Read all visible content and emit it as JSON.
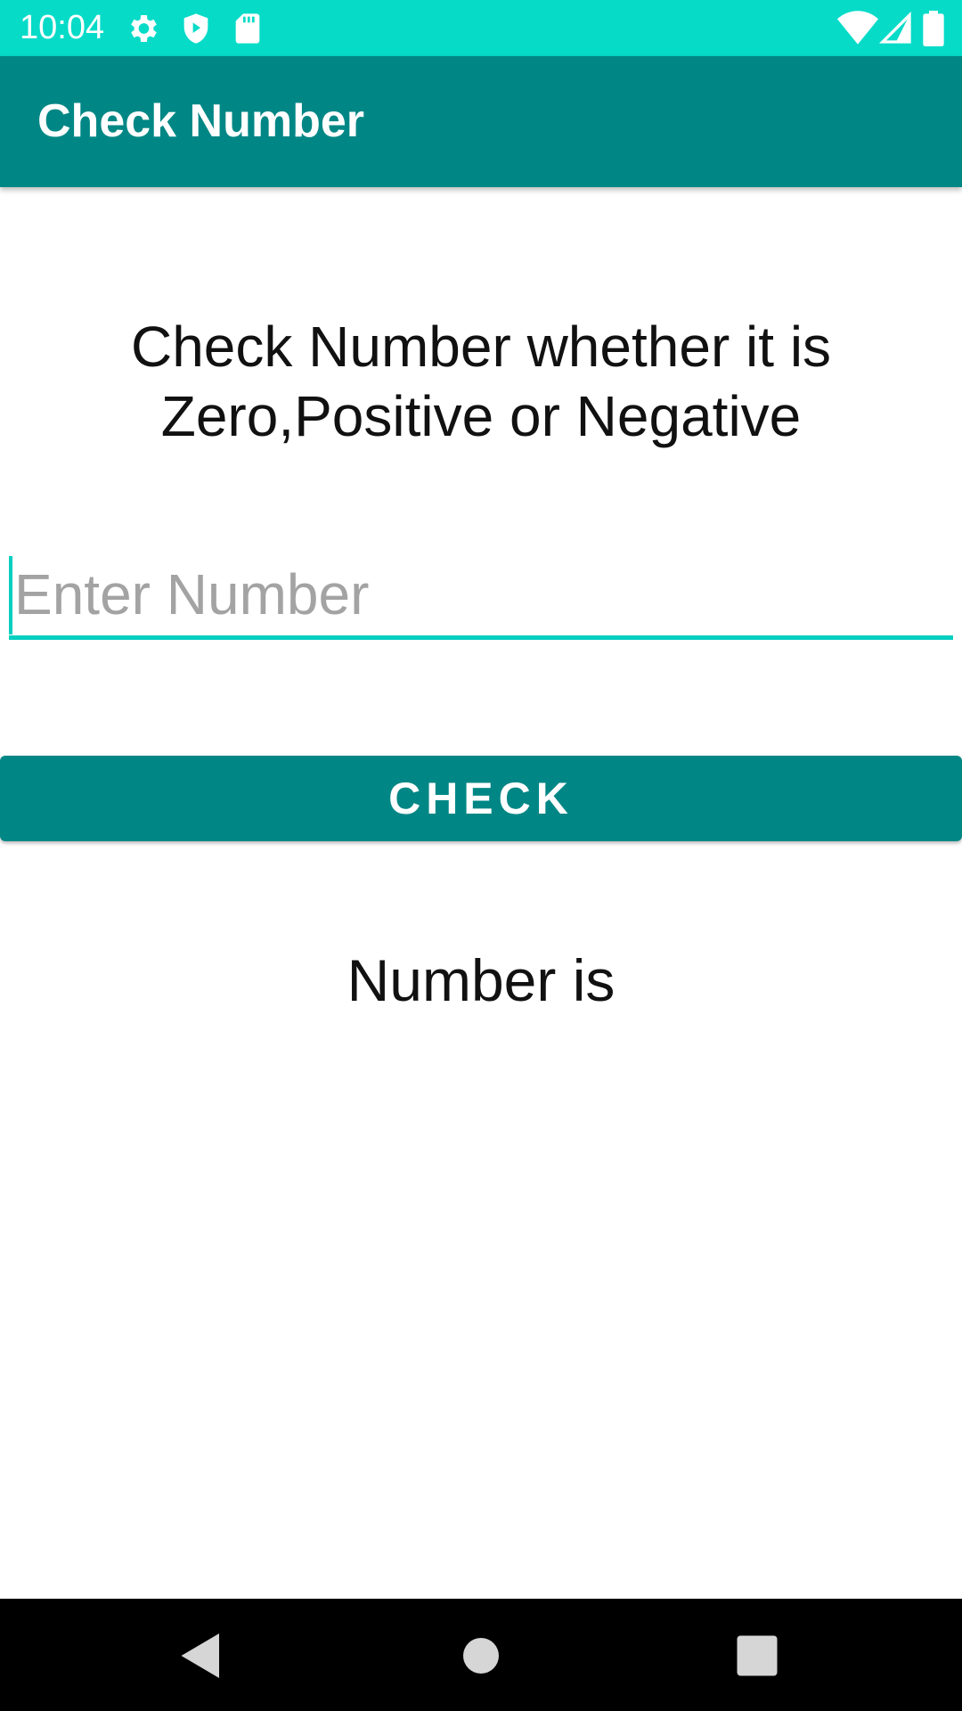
{
  "status_bar": {
    "time": "10:04",
    "icons_left": [
      "gear-icon",
      "shield-icon",
      "sd-card-icon"
    ],
    "icons_right": [
      "wifi-icon",
      "signal-icon",
      "battery-icon"
    ],
    "background": "#06dbc8"
  },
  "app_bar": {
    "title": "Check Number",
    "background": "#008785"
  },
  "main": {
    "heading_line1": "Check Number whether it is",
    "heading_line2": "Zero,Positive or Negative",
    "input": {
      "placeholder": "Enter Number",
      "value": ""
    },
    "check_button_label": "CHECK",
    "result_text": "Number is"
  },
  "nav_bar": {
    "buttons": [
      "back-icon",
      "home-icon",
      "recents-icon"
    ]
  },
  "colors": {
    "accent": "#06cfc0",
    "primary": "#008785"
  }
}
